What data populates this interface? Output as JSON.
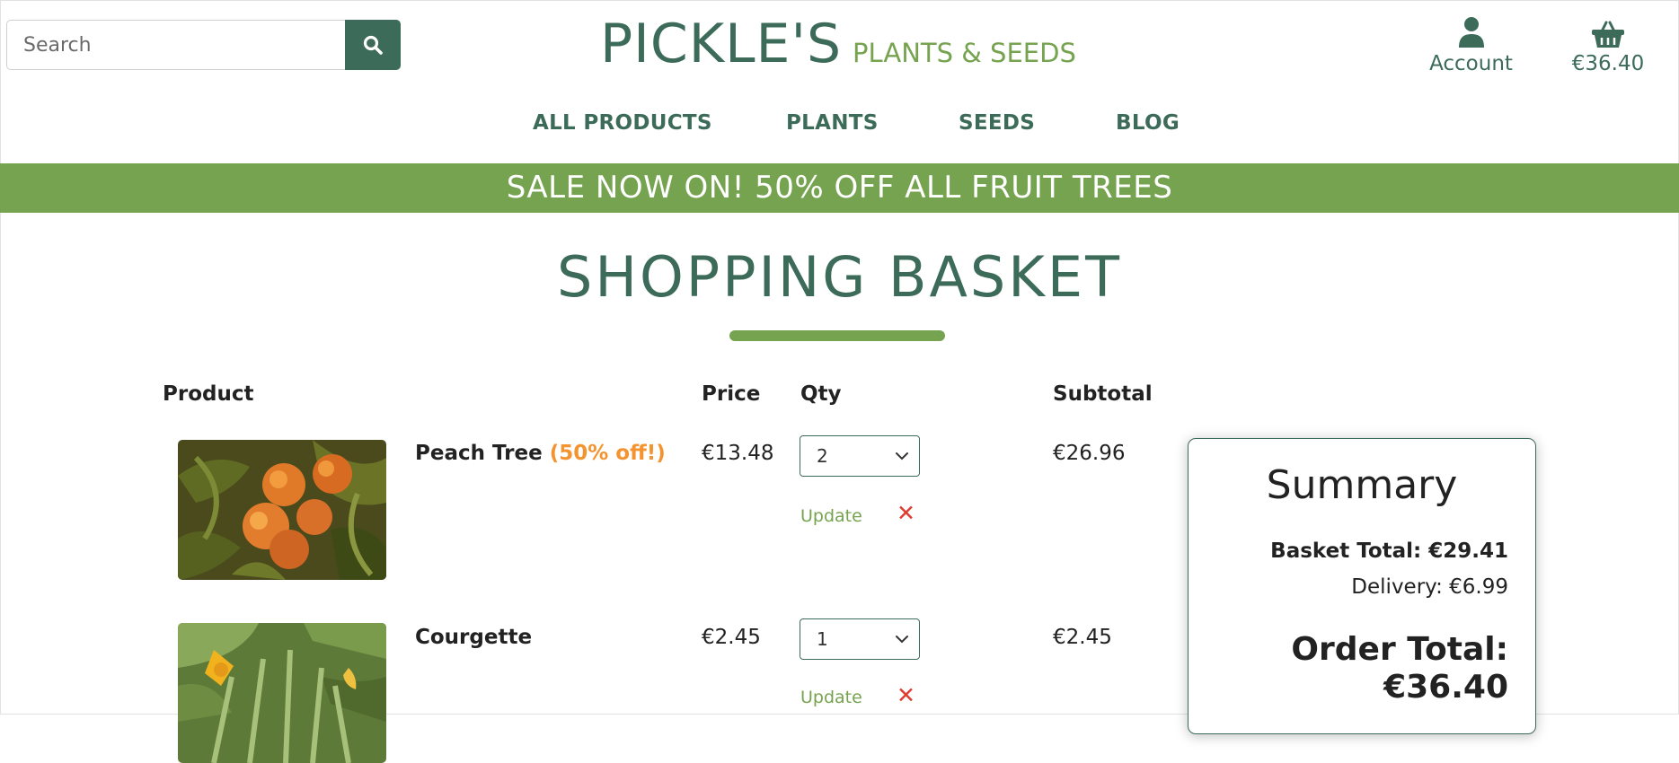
{
  "header": {
    "search": {
      "placeholder": "Search"
    },
    "brand": {
      "name": "PICKLE'S",
      "tagline": "PLANTS & SEEDS"
    },
    "account_label": "Account",
    "basket_total": "€36.40"
  },
  "nav": {
    "items": [
      "ALL PRODUCTS",
      "PLANTS",
      "SEEDS",
      "BLOG"
    ]
  },
  "banner": {
    "text": "SALE NOW ON! 50% OFF ALL FRUIT TREES"
  },
  "page": {
    "title": "SHOPPING BASKET"
  },
  "table": {
    "headers": {
      "product": "Product",
      "price": "Price",
      "qty": "Qty",
      "subtotal": "Subtotal"
    },
    "rows": [
      {
        "name": "Peach Tree",
        "sale_note": "(50% off!)",
        "price": "€13.48",
        "qty": "2",
        "subtotal": "€26.96",
        "update_label": "Update",
        "remove_icon": "close-x-icon"
      },
      {
        "name": "Courgette",
        "sale_note": "",
        "price": "€2.45",
        "qty": "1",
        "subtotal": "€2.45",
        "update_label": "Update",
        "remove_icon": "close-x-icon"
      }
    ]
  },
  "summary": {
    "title": "Summary",
    "basket_total": "Basket Total: €29.41",
    "delivery": "Delivery: €6.99",
    "order_total_label": "Order Total:",
    "order_total_value": "€36.40"
  },
  "colors": {
    "brand_dark_green": "#3d6b5a",
    "brand_light_green": "#76a34f",
    "sale_orange": "#f39430",
    "remove_red": "#e03b2e"
  },
  "icons": [
    "search-icon",
    "user-icon",
    "basket-icon",
    "chevron-down-icon",
    "close-x-icon"
  ]
}
